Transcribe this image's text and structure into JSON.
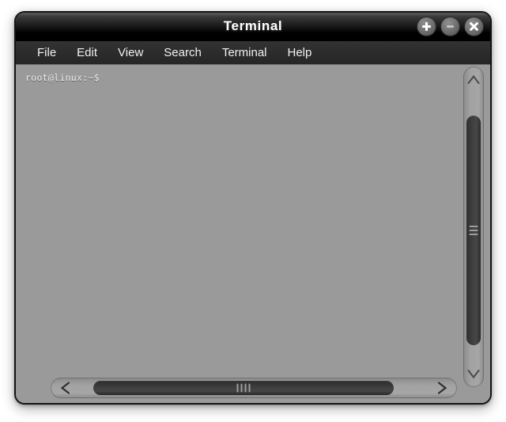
{
  "window": {
    "title": "Terminal",
    "controls": [
      {
        "name": "maximize-button",
        "icon": "plus-icon",
        "label": "+"
      },
      {
        "name": "minimize-button",
        "icon": "minus-icon",
        "label": "−"
      },
      {
        "name": "close-button",
        "icon": "close-icon",
        "label": "✕"
      }
    ]
  },
  "menubar": {
    "items": [
      {
        "label": "File"
      },
      {
        "label": "Edit"
      },
      {
        "label": "View"
      },
      {
        "label": "Search"
      },
      {
        "label": "Terminal"
      },
      {
        "label": "Help"
      }
    ]
  },
  "terminal": {
    "prompt": "root@linux:~$",
    "lines": [
      "root@linux:~$"
    ],
    "background_color": "#9a9a9a",
    "text_color": "#f0f0f0"
  },
  "scrollbars": {
    "vertical": {
      "up_arrow_icon": "chevron-up-icon",
      "down_arrow_icon": "chevron-down-icon",
      "thumb_grip_lines": 3
    },
    "horizontal": {
      "left_arrow_icon": "chevron-left-icon",
      "right_arrow_icon": "chevron-right-icon",
      "thumb_grip_lines": 4
    }
  },
  "colors": {
    "titlebar": "#000000",
    "menubar": "#2c2c2c",
    "window_border": "#141414",
    "scroll_thumb": "#3f3f3f",
    "scroll_track": "#a4a4a4"
  }
}
